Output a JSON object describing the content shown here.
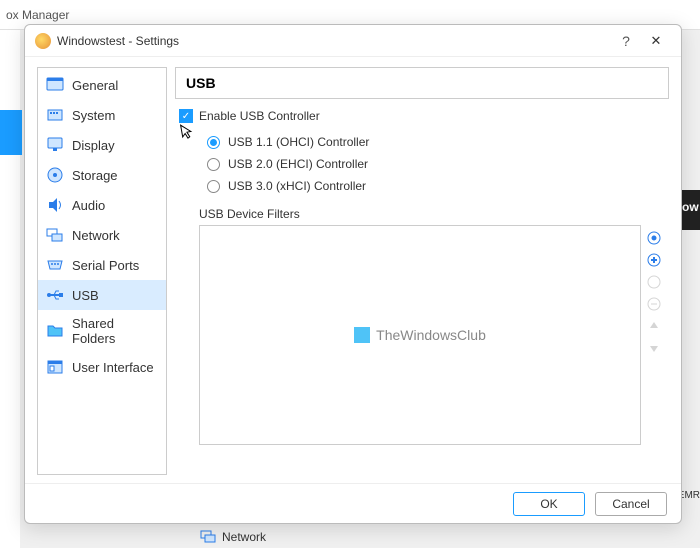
{
  "bg": {
    "app_title": "ox Manager",
    "right_text": "ow",
    "oemr": "_OEMR",
    "network_label": "Network"
  },
  "dialog": {
    "title": "Windowstest - Settings",
    "help": "?",
    "close": "✕"
  },
  "sidebar": {
    "items": [
      {
        "label": "General"
      },
      {
        "label": "System"
      },
      {
        "label": "Display"
      },
      {
        "label": "Storage"
      },
      {
        "label": "Audio"
      },
      {
        "label": "Network"
      },
      {
        "label": "Serial Ports"
      },
      {
        "label": "USB"
      },
      {
        "label": "Shared Folders"
      },
      {
        "label": "User Interface"
      }
    ],
    "selected": "USB"
  },
  "main": {
    "header": "USB",
    "enable_label": "Enable USB Controller",
    "enable_checked": true,
    "radios": [
      {
        "label": "USB 1.1 (OHCI) Controller",
        "selected": true
      },
      {
        "label": "USB 2.0 (EHCI) Controller",
        "selected": false
      },
      {
        "label": "USB 3.0 (xHCI) Controller",
        "selected": false
      }
    ],
    "filters_label": "USB Device Filters",
    "watermark": "TheWindowsClub"
  },
  "footer": {
    "ok": "OK",
    "cancel": "Cancel"
  }
}
